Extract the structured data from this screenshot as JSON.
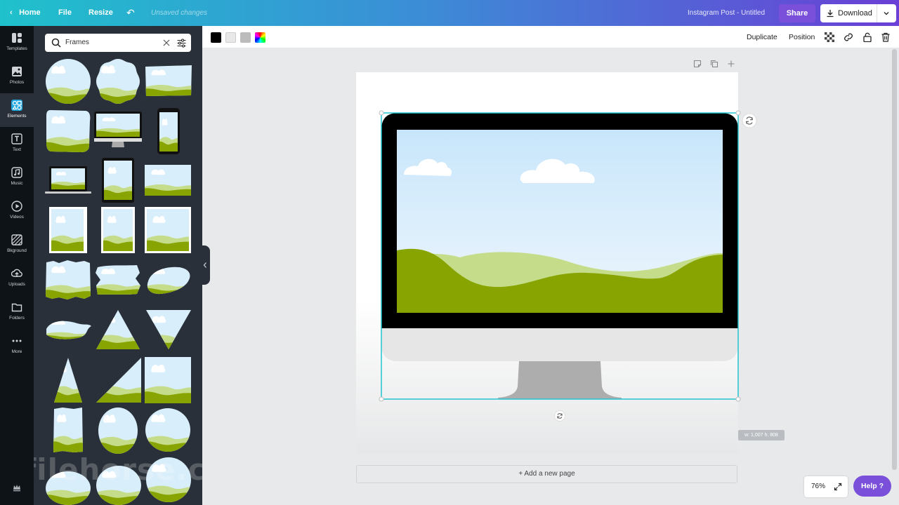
{
  "topbar": {
    "home": "Home",
    "file": "File",
    "resize": "Resize",
    "status": "Unsaved changes",
    "doc_title": "Instagram Post - Untitled",
    "share": "Share",
    "download": "Download"
  },
  "rail": {
    "items": [
      {
        "label": "Templates",
        "icon": "templates-icon"
      },
      {
        "label": "Photos",
        "icon": "photos-icon"
      },
      {
        "label": "Elements",
        "icon": "elements-icon"
      },
      {
        "label": "Text",
        "icon": "text-icon"
      },
      {
        "label": "Music",
        "icon": "music-icon"
      },
      {
        "label": "Videos",
        "icon": "videos-icon"
      },
      {
        "label": "Bkground",
        "icon": "background-icon"
      },
      {
        "label": "Uploads",
        "icon": "uploads-icon"
      },
      {
        "label": "Folders",
        "icon": "folders-icon"
      },
      {
        "label": "More",
        "icon": "more-icon"
      }
    ]
  },
  "search": {
    "value": "Frames"
  },
  "toolbar": {
    "swatches": [
      "#000000",
      "#e8e8e8",
      "#bcbcbc"
    ],
    "duplicate": "Duplicate",
    "position": "Position"
  },
  "canvas": {
    "add_page": "+ Add a new page",
    "dims": "w: 1,007 h: 808",
    "zoom": "76%"
  },
  "help": "Help",
  "watermark": "filehorse.com",
  "colors": {
    "sky": "#d3ecfb",
    "grass": "#88a400",
    "grass_light": "#c5dc8a",
    "selection": "#21c4d0",
    "accent": "#7a4fd9"
  }
}
